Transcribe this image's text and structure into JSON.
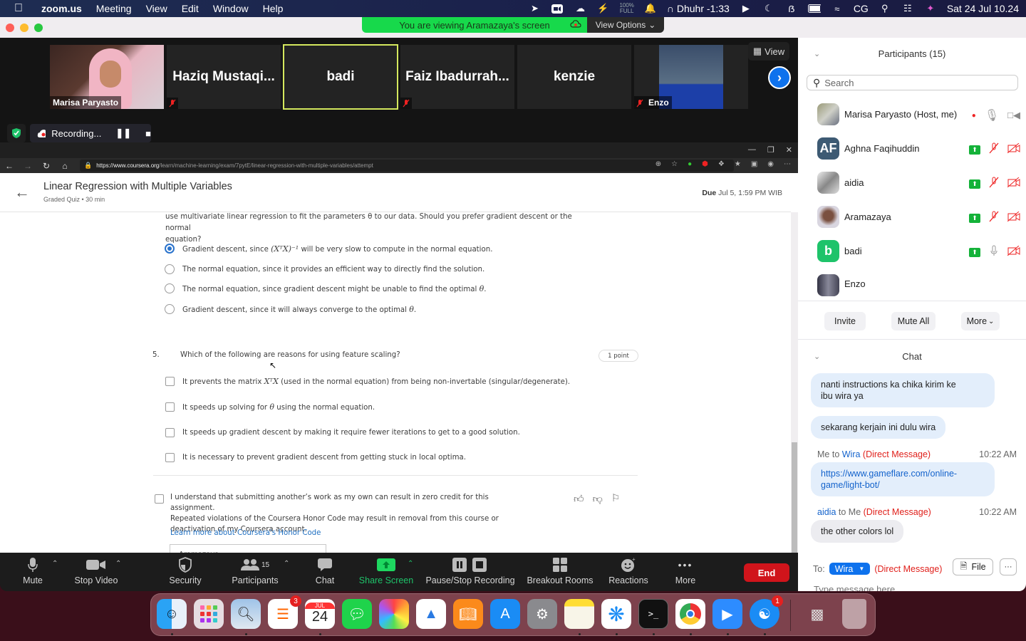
{
  "menubar": {
    "app": "zoom.us",
    "items": [
      "Meeting",
      "View",
      "Edit",
      "Window",
      "Help"
    ],
    "battery_status_top": "100%",
    "battery_status_bottom": "FULL",
    "prayer": "Dhuhr -1:33",
    "user_initials": "CG",
    "datetime": "Sat 24 Jul  10.24"
  },
  "banner": {
    "text": "You are viewing Aramazaya's screen",
    "view_options": "View Options"
  },
  "video_strip": {
    "tiles": [
      {
        "name": "Marisa Paryasto",
        "type": "video",
        "muted": false
      },
      {
        "name": "Haziq Mustaqi...",
        "type": "name",
        "muted": true
      },
      {
        "name": "badi",
        "type": "name",
        "muted": false,
        "active_speaker": true
      },
      {
        "name": "Faiz Ibadurrah...",
        "type": "name",
        "muted": true
      },
      {
        "name": "kenzie",
        "type": "name",
        "muted": false
      },
      {
        "name": "Enzo",
        "type": "image",
        "muted": true
      }
    ],
    "view_label": "View"
  },
  "recording": {
    "label": "Recording..."
  },
  "browser": {
    "url_scheme": "https://",
    "url_host": "www.coursera.org",
    "url_path": "/learn/machine-learning/exam/7pytE/linear-regression-with-multiple-variables/attempt"
  },
  "quiz": {
    "title": "Linear Regression with Multiple Variables",
    "subtitle": "Graded Quiz • 30 min",
    "due_label": "Due",
    "due_value": "Jul 5, 1:59 PM WIB",
    "q4": {
      "text_line1": "use multivariate linear regression to fit the parameters θ to our data. Should you prefer gradient descent or the normal",
      "text_line2": "equation?",
      "options": [
        {
          "pre": "Gradient descent, since ",
          "math": "(XᵀX)⁻¹",
          "post": " will be very slow to compute in the normal equation.",
          "selected": true
        },
        {
          "pre": "The normal equation, since it provides an efficient way to directly find the solution.",
          "math": "",
          "post": "",
          "selected": false
        },
        {
          "pre": "The normal equation, since gradient descent might be unable to find the optimal ",
          "math": "θ",
          "post": ".",
          "selected": false
        },
        {
          "pre": "Gradient descent, since it will always converge to the optimal ",
          "math": "θ",
          "post": ".",
          "selected": false
        }
      ]
    },
    "q5": {
      "number": "5.",
      "text": "Which of the following are reasons for using feature scaling?",
      "points": "1 point",
      "options": [
        {
          "pre": "It prevents the matrix ",
          "math": "XᵀX",
          "post": " (used in the normal equation) from being non-invertable (singular/degenerate).",
          "checked": false
        },
        {
          "pre": "It speeds up solving for ",
          "math": "θ",
          "post": " using the normal equation.",
          "checked": false
        },
        {
          "pre": "It speeds up gradient descent by making it require fewer iterations to get to a good solution.",
          "math": "",
          "post": "",
          "checked": false
        },
        {
          "pre": "It is necessary to prevent gradient descent from getting stuck in local optima.",
          "math": "",
          "post": "",
          "checked": false
        }
      ]
    },
    "honor": {
      "line1": "I understand that submitting another’s work as my own can result in zero credit for this assignment.",
      "line2": "Repeated violations of the Coursera Honor Code may result in removal from this course or",
      "line3": "deactivation of my Coursera account.",
      "link": "Learn more about Coursera's Honor Code",
      "name_value": "Aramazaya"
    }
  },
  "toolbar": {
    "mute": "Mute",
    "stop_video": "Stop Video",
    "security": "Security",
    "participants": "Participants",
    "participants_count": "15",
    "chat": "Chat",
    "share_screen": "Share Screen",
    "pause_stop_recording": "Pause/Stop Recording",
    "breakout_rooms": "Breakout Rooms",
    "reactions": "Reactions",
    "more": "More",
    "end": "End"
  },
  "participants_panel": {
    "title": "Participants (15)",
    "search_placeholder": "Search",
    "list": [
      {
        "name": "Marisa Paryasto  (Host, me)",
        "initials": "",
        "color": "#8a8a70",
        "hand": false,
        "recording": true,
        "mic": "on",
        "video": "on"
      },
      {
        "name": "Aghna Faqihuddin",
        "initials": "AF",
        "color": "#3d5a73",
        "hand": true,
        "mic": "muted",
        "video": "off"
      },
      {
        "name": "aidia",
        "initials": "",
        "color": "#d8d8d8",
        "hand": true,
        "mic": "muted",
        "video": "off"
      },
      {
        "name": "Aramazaya",
        "initials": "",
        "color": "#9a7a6a",
        "hand": true,
        "mic": "muted",
        "video": "off"
      },
      {
        "name": "badi",
        "initials": "b",
        "color": "#1ec36a",
        "hand": true,
        "mic": "on",
        "video": "off"
      },
      {
        "name": "Enzo",
        "initials": "",
        "color": "#445566",
        "hand": true,
        "mic": "muted",
        "video": "off"
      }
    ],
    "invite": "Invite",
    "mute_all": "Mute All",
    "more": "More"
  },
  "chat": {
    "title": "Chat",
    "messages": [
      {
        "text_line1": "nanti instructions ka chika kirim ke",
        "text_line2": "ibu wira ya"
      },
      {
        "text": "sekarang kerjain ini dulu wira"
      },
      {
        "from": "Me",
        "to_word": " to ",
        "to": "Wira",
        "tag": " (Direct Message)",
        "time": "10:22 AM",
        "text_line1": "https://www.gameflare.com/online-",
        "text_line2": "game/light-bot/"
      },
      {
        "from": "aidia",
        "to_word": " to ",
        "to": "Me",
        "tag": " (Direct Message)",
        "time": "10:22 AM",
        "text": "the other colors lol"
      }
    ],
    "to_label": "To:",
    "recipient": "Wira",
    "recipient_tag": "(Direct Message)",
    "file_label": "File",
    "more_label": "···",
    "input_placeholder": "Type message here..."
  },
  "dock": {
    "apps": [
      "Finder",
      "Launchpad",
      "Preview",
      "Reminders",
      "Calendar",
      "Messages",
      "Photos",
      "Keynote",
      "Books",
      "App Store",
      "System Preferences",
      "Notes",
      "Safari",
      "Terminal",
      "Chrome",
      "Zoom",
      "Telegram-like",
      "Screenshot",
      "Trash"
    ],
    "reminders_badge": "3",
    "calendar_month": "JUL",
    "calendar_day": "24",
    "app17_badge": "1"
  }
}
